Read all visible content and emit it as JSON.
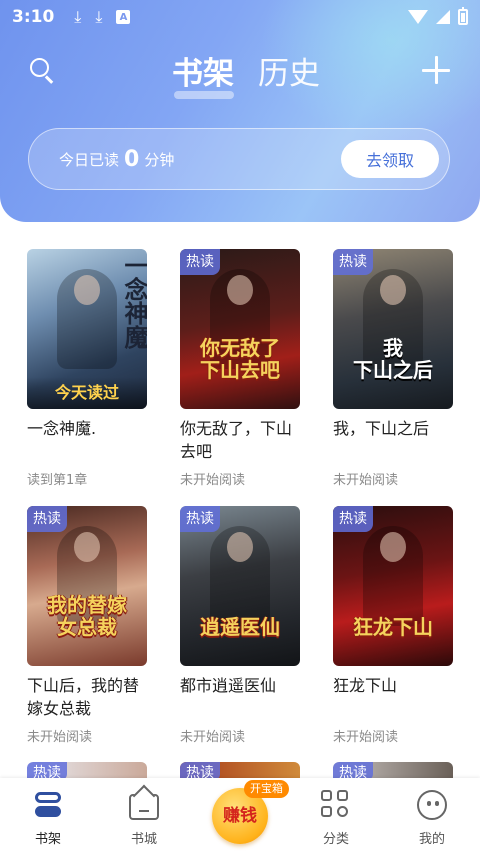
{
  "status_bar": {
    "time": "3:10",
    "icon_a": "A"
  },
  "header": {
    "tab_active": "书架",
    "tab_inactive": "历史"
  },
  "reading": {
    "prefix": "今日已读",
    "minutes": "0",
    "suffix": "分钟",
    "claim_label": "去领取"
  },
  "books": [
    {
      "title": "一念神魔.",
      "status": "读到第1章",
      "cover_title": "一念神魔",
      "cover_banner": "今天读过",
      "badge": ""
    },
    {
      "title": "你无敌了，下山去吧",
      "status": "未开始阅读",
      "cover_title": "你无敌了\n下山去吧",
      "badge": "热读"
    },
    {
      "title": "我，下山之后",
      "status": "未开始阅读",
      "cover_title": "我\n下山之后",
      "badge": "热读"
    },
    {
      "title": "下山后，我的替嫁女总裁",
      "status": "未开始阅读",
      "cover_title": "我的替嫁\n女总裁",
      "badge": "热读"
    },
    {
      "title": "都市逍遥医仙",
      "status": "未开始阅读",
      "cover_title": "逍遥医仙",
      "badge": "热读"
    },
    {
      "title": "狂龙下山",
      "status": "未开始阅读",
      "cover_title": "狂龙下山",
      "badge": "热读"
    }
  ],
  "peek_badges": [
    "热读",
    "热读",
    "热读"
  ],
  "bottom_nav": {
    "shelf": "书架",
    "store": "书城",
    "earn": "赚钱",
    "earn_tag": "开宝箱",
    "category": "分类",
    "me": "我的"
  },
  "colors": {
    "header_gradient_start": "#6f93ee",
    "header_gradient_end": "#9bc4f7",
    "claim_text": "#4670d9",
    "badge_bg": "#606edc",
    "earn_orange": "#ffb21a"
  }
}
